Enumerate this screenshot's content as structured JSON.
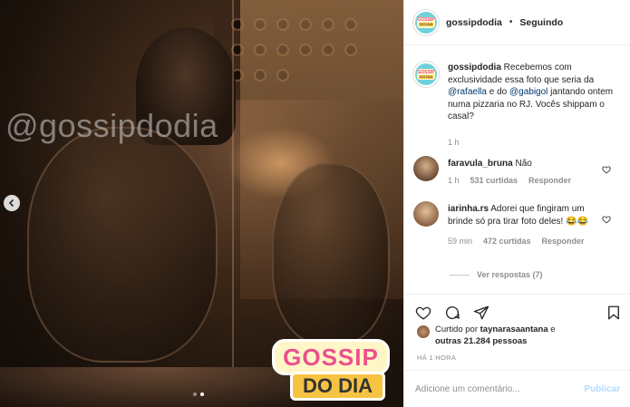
{
  "photo": {
    "watermark": "@gossipdodia",
    "overlay_logo_top": "GOSSIP",
    "overlay_logo_bottom": "DO DIA"
  },
  "header": {
    "avatar_top": "GOSSIP",
    "avatar_bottom": "DO DIA",
    "username": "gossipdodia",
    "separator": "•",
    "follow_status": "Seguindo"
  },
  "caption": {
    "username": "gossipdodia",
    "text_1": " Recebemos com exclusividade essa foto que seria da ",
    "mention_1": "@rafaella",
    "text_2": " e do ",
    "mention_2": "@gabigol",
    "text_3": " jantando ontem numa pizzaria no RJ. Vocês shippam o casal?",
    "time": "1 h"
  },
  "comments": [
    {
      "username": "faravula_bruna",
      "text": " Não",
      "time": "1 h",
      "likes": "531 curtidas",
      "reply": "Responder"
    },
    {
      "username": "iarinha.rs",
      "text": " Adorei que fingiram um brinde só pra tirar foto deles! 😂😂",
      "time": "59 min",
      "likes": "472 curtidas",
      "reply": "Responder",
      "view_replies": "Ver respostas (7)"
    }
  ],
  "likes": {
    "prefix": "Curtido por ",
    "user": "taynarasaantana",
    "middle": " e ",
    "others": "outras 21.284 pessoas"
  },
  "timestamp": "HÁ 1 HORA",
  "add_comment": {
    "placeholder": "Adicione um comentário...",
    "post_label": "Publicar"
  },
  "colors": {
    "link": "#00376b",
    "muted": "#8e8e8e",
    "post_disabled": "#b3dbff",
    "logo_pink": "#ee4f8b",
    "logo_yellow": "#f7c342"
  },
  "icons": [
    "chevron-left-icon",
    "heart-icon",
    "comment-icon",
    "share-icon",
    "bookmark-icon"
  ]
}
